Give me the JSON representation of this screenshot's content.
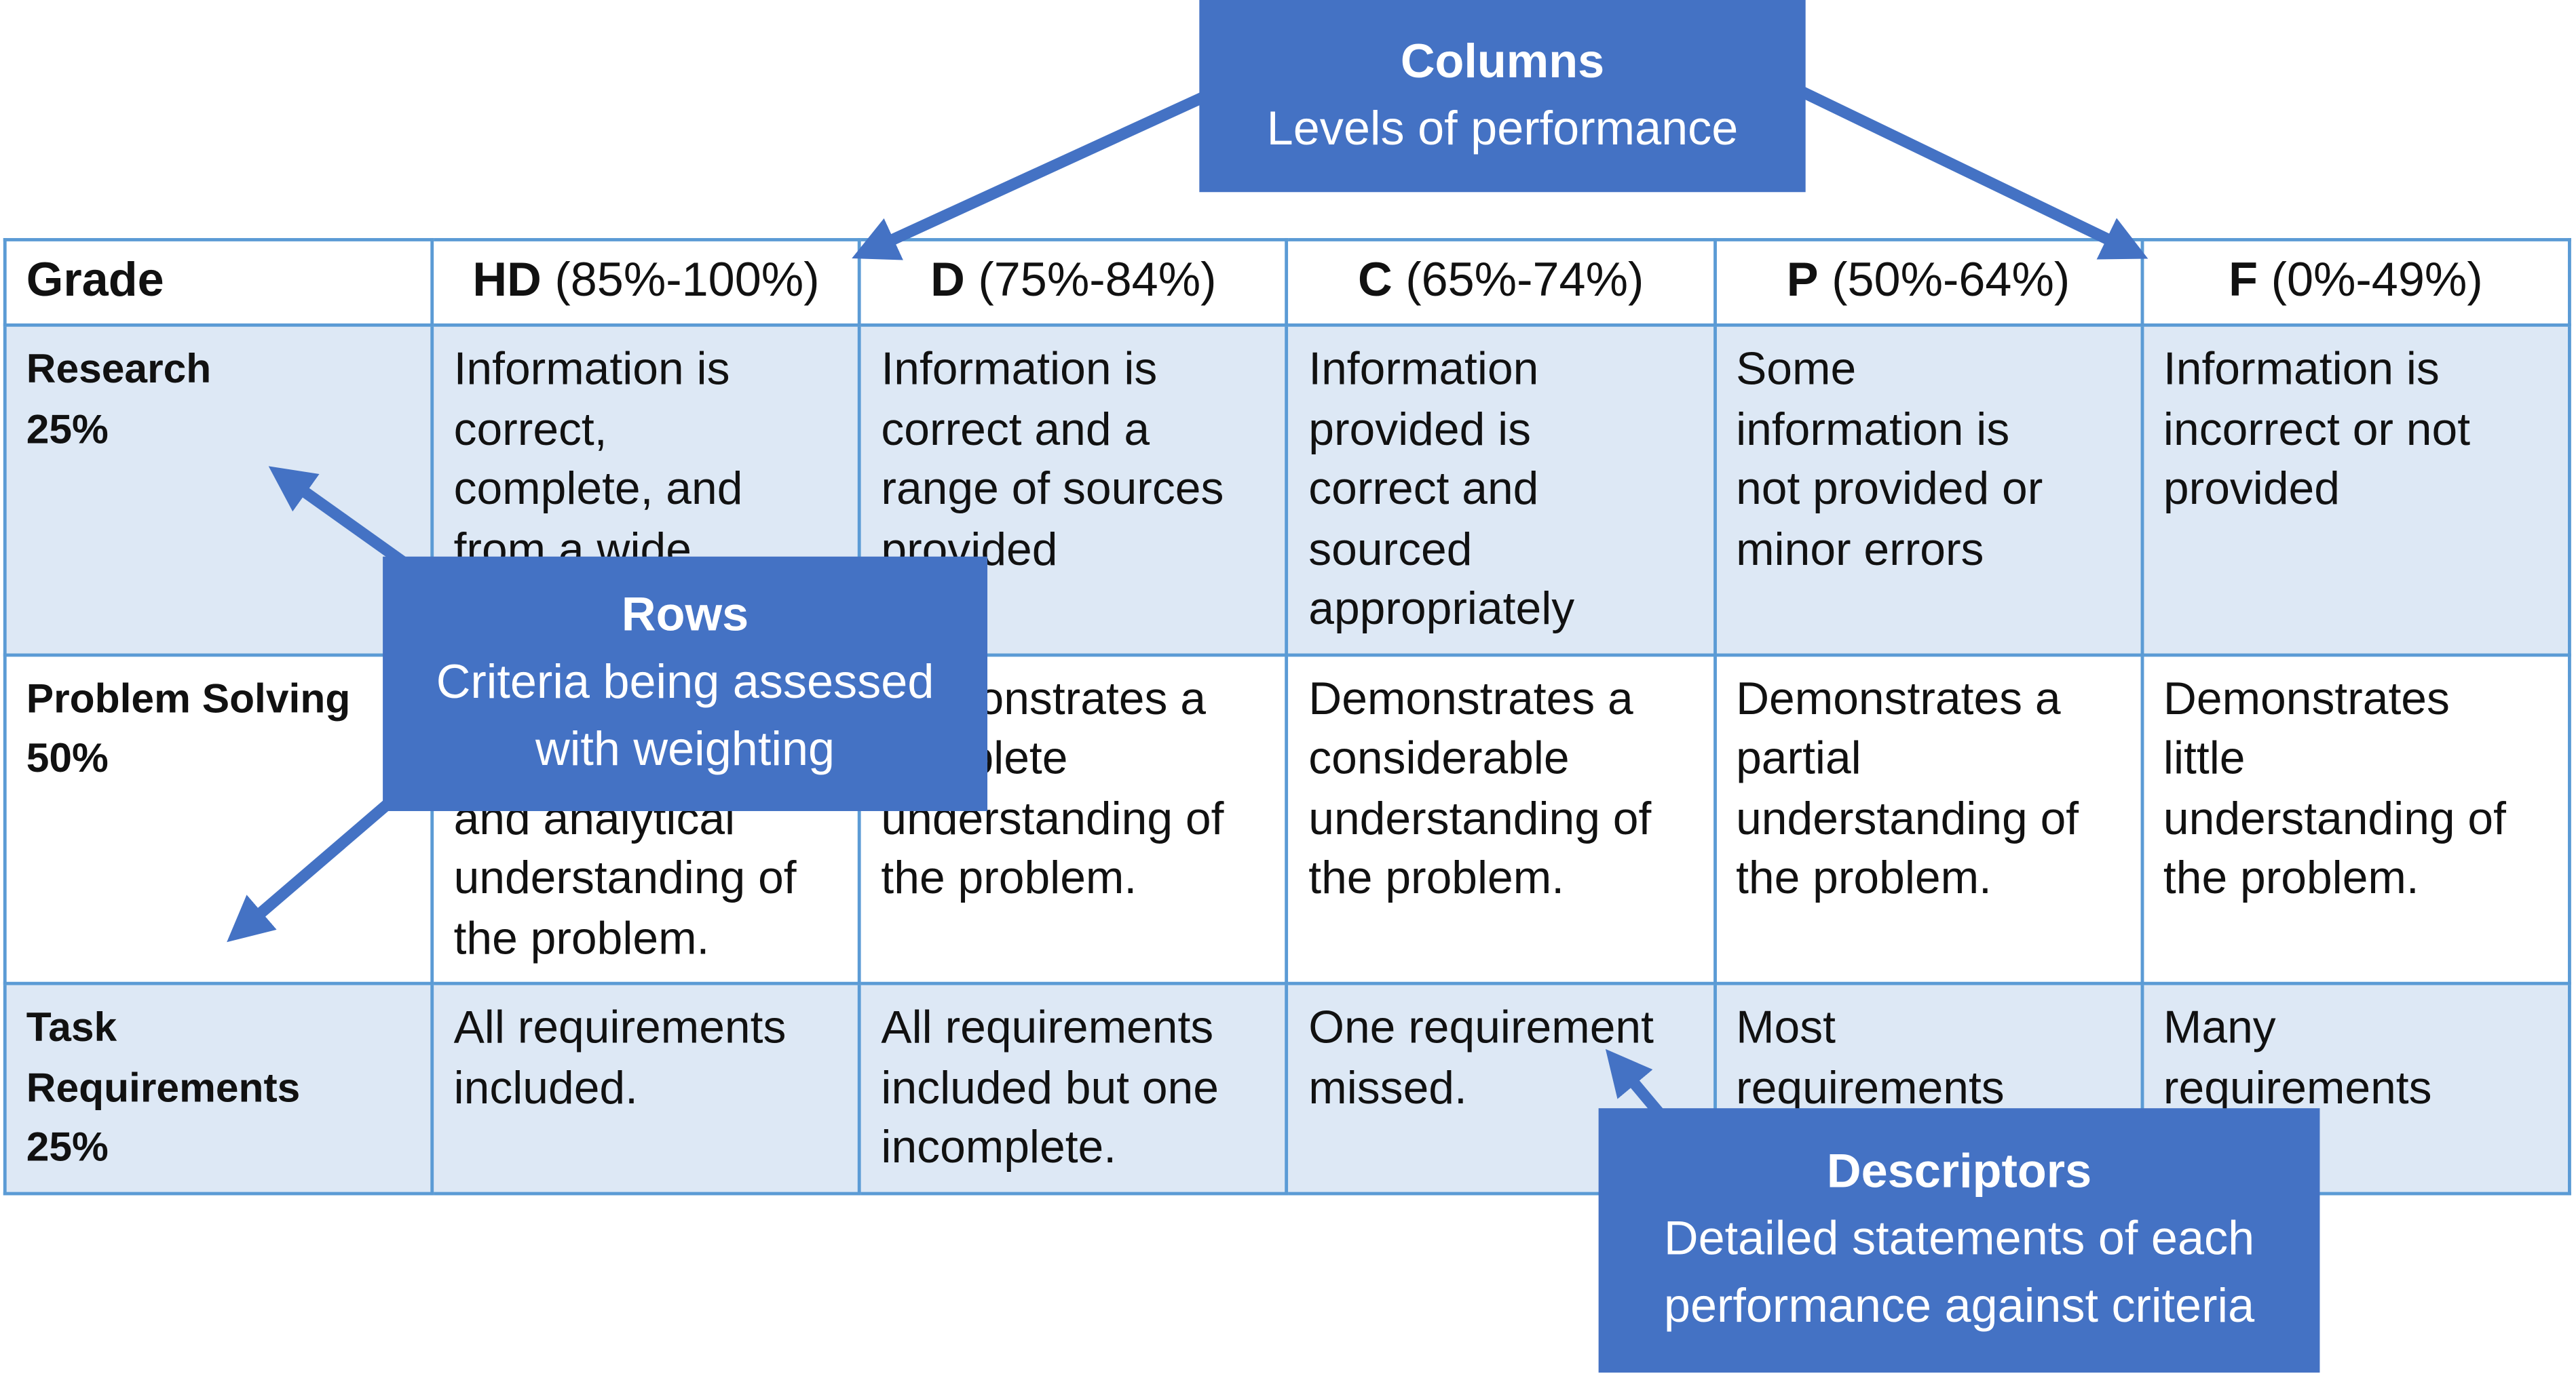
{
  "table": {
    "header": [
      {
        "bold": "Grade",
        "rest": ""
      },
      {
        "bold": "HD",
        "rest": " (85%-100%)"
      },
      {
        "bold": "D",
        "rest": " (75%-84%)"
      },
      {
        "bold": "C",
        "rest": " (65%-74%)"
      },
      {
        "bold": "P",
        "rest": " (50%-64%)"
      },
      {
        "bold": "F",
        "rest": " (0%-49%)"
      }
    ],
    "rows": [
      {
        "criterion": [
          "Research",
          "25%"
        ],
        "cells": [
          [
            "Information is",
            "correct,",
            "complete, and",
            "from a wide"
          ],
          [
            "Information is",
            "correct and a",
            "range of sources",
            "provided"
          ],
          [
            "Information",
            "provided is",
            "correct and",
            "sourced",
            "appropriately"
          ],
          [
            "Some",
            "information is",
            "not provided or",
            "minor errors"
          ],
          [
            "Information is",
            "incorrect or not",
            "provided"
          ]
        ]
      },
      {
        "criterion": [
          "Problem Solving",
          "50%"
        ],
        "cells": [
          [
            "",
            "",
            "and analytical",
            "understanding of",
            "the problem."
          ],
          [
            "Demonstrates a",
            "complete",
            "understanding of",
            "the problem."
          ],
          [
            "Demonstrates a",
            "considerable",
            "understanding of",
            "the problem."
          ],
          [
            "Demonstrates a",
            "partial",
            "understanding of",
            "the problem."
          ],
          [
            "Demonstrates",
            "little",
            "understanding of",
            "the problem."
          ]
        ]
      },
      {
        "criterion": [
          "Task",
          "Requirements",
          "25%"
        ],
        "cells": [
          [
            "All requirements",
            "included."
          ],
          [
            "All requirements",
            "included but one",
            "incomplete."
          ],
          [
            "One requirement",
            "missed."
          ],
          [
            "Most",
            "requirements"
          ],
          [
            "Many",
            "requirements"
          ]
        ]
      }
    ]
  },
  "callouts": {
    "columns": {
      "title": "Columns",
      "text": "Levels of performance"
    },
    "rows": {
      "title": "Rows",
      "text": "Criteria being assessed with weighting"
    },
    "descriptors": {
      "title": "Descriptors",
      "text": "Detailed statements of each performance against criteria"
    }
  },
  "colors": {
    "callout": "#4472c4",
    "border": "#5b9bd5",
    "row_fill": "#dde8f5"
  }
}
